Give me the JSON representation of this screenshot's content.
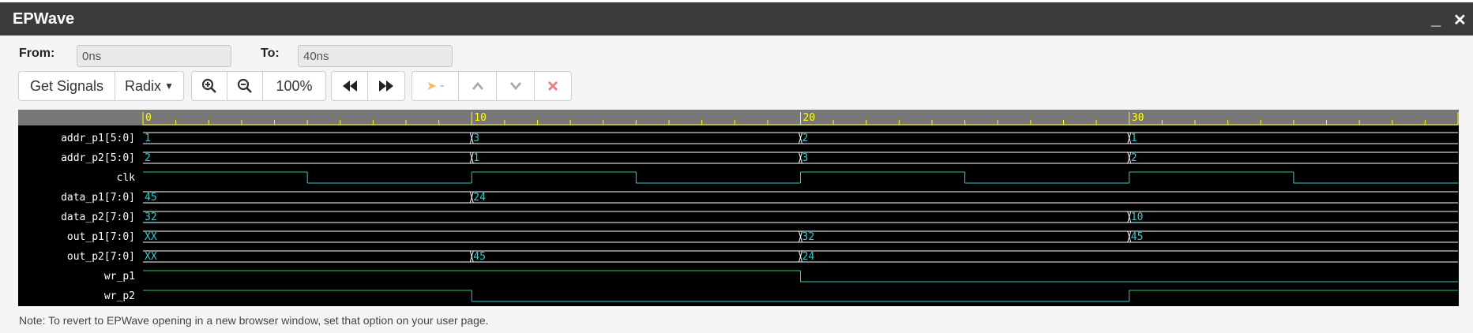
{
  "window": {
    "title": "EPWave",
    "minimize_icon": "minimize-icon",
    "close_icon": "close-icon"
  },
  "range": {
    "from_label": "From:",
    "from_value": "0ns",
    "to_label": "To:",
    "to_value": "40ns"
  },
  "toolbar": {
    "get_signals": "Get Signals",
    "radix": "Radix",
    "zoom_in_icon": "zoom-in-icon",
    "zoom_out_icon": "zoom-out-icon",
    "zoom_level": "100%",
    "prev_icon": "fast-backward-icon",
    "next_icon": "fast-forward-icon",
    "cursor_value": "-",
    "up_icon": "chevron-up-icon",
    "down_icon": "chevron-down-icon",
    "remove_icon": "remove-icon"
  },
  "waveform": {
    "time_end": 40,
    "time_ticks": [
      "0",
      "10",
      "20",
      "30"
    ],
    "signals": [
      {
        "name": "addr_p1[5:0]",
        "type": "bus",
        "segments": [
          {
            "t": 0,
            "v": "1"
          },
          {
            "t": 10,
            "v": "3"
          },
          {
            "t": 20,
            "v": "2"
          },
          {
            "t": 30,
            "v": "1"
          }
        ]
      },
      {
        "name": "addr_p2[5:0]",
        "type": "bus",
        "segments": [
          {
            "t": 0,
            "v": "2"
          },
          {
            "t": 10,
            "v": "1"
          },
          {
            "t": 20,
            "v": "3"
          },
          {
            "t": 30,
            "v": "2"
          }
        ]
      },
      {
        "name": "clk",
        "type": "bit",
        "transitions": [
          {
            "t": 0,
            "v": 1
          },
          {
            "t": 5,
            "v": 0
          },
          {
            "t": 10,
            "v": 1
          },
          {
            "t": 15,
            "v": 0
          },
          {
            "t": 20,
            "v": 1
          },
          {
            "t": 25,
            "v": 0
          },
          {
            "t": 30,
            "v": 1
          },
          {
            "t": 35,
            "v": 0
          }
        ]
      },
      {
        "name": "data_p1[7:0]",
        "type": "bus",
        "segments": [
          {
            "t": 0,
            "v": "45"
          },
          {
            "t": 10,
            "v": "24"
          }
        ]
      },
      {
        "name": "data_p2[7:0]",
        "type": "bus",
        "segments": [
          {
            "t": 0,
            "v": "32"
          },
          {
            "t": 30,
            "v": "10"
          }
        ]
      },
      {
        "name": "out_p1[7:0]",
        "type": "bus",
        "segments": [
          {
            "t": 0,
            "v": "XX"
          },
          {
            "t": 20,
            "v": "32"
          },
          {
            "t": 30,
            "v": "45"
          }
        ]
      },
      {
        "name": "out_p2[7:0]",
        "type": "bus",
        "segments": [
          {
            "t": 0,
            "v": "XX"
          },
          {
            "t": 10,
            "v": "45"
          },
          {
            "t": 20,
            "v": "24"
          }
        ]
      },
      {
        "name": "wr_p1",
        "type": "bit",
        "transitions": [
          {
            "t": 0,
            "v": 1
          },
          {
            "t": 20,
            "v": 0
          }
        ]
      },
      {
        "name": "wr_p2",
        "type": "bit",
        "transitions": [
          {
            "t": 0,
            "v": 1
          },
          {
            "t": 10,
            "v": 0
          },
          {
            "t": 30,
            "v": 1
          }
        ]
      }
    ]
  },
  "colors": {
    "ruler_bg": "#777777",
    "ruler_line": "#ffff00",
    "wave": "#33cccc",
    "bus_line": "#ffffff",
    "high_line": "#33cc66",
    "label": "#ffffff"
  },
  "note": "Note: To revert to EPWave opening in a new browser window, set that option on your user page."
}
